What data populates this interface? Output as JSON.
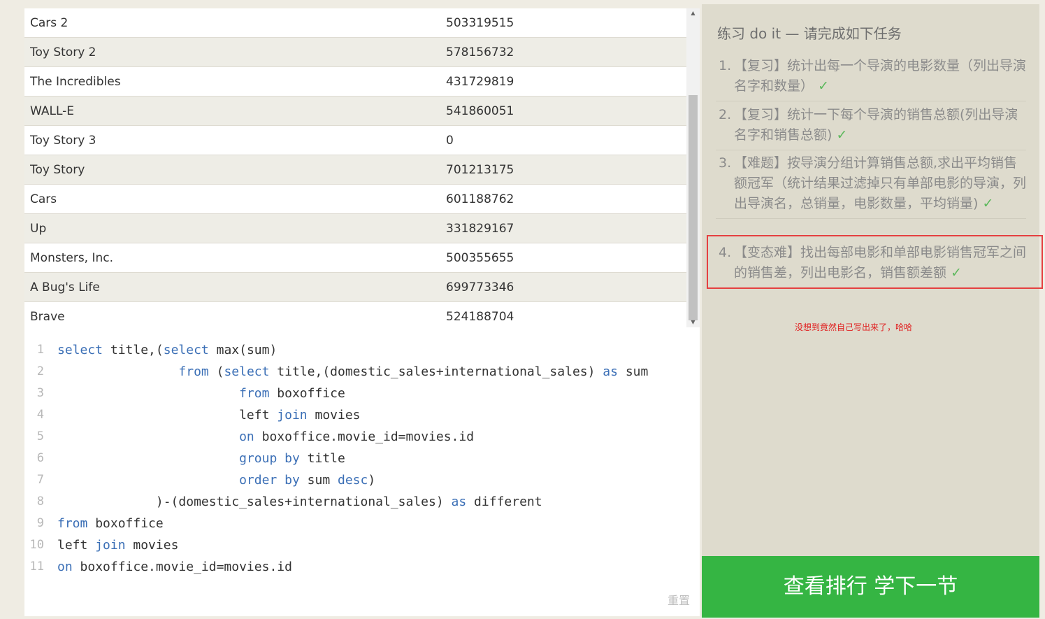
{
  "results": {
    "rows": [
      {
        "title": "Cars 2",
        "value": "503319515"
      },
      {
        "title": "Toy Story 2",
        "value": "578156732"
      },
      {
        "title": "The Incredibles",
        "value": "431729819"
      },
      {
        "title": "WALL-E",
        "value": "541860051"
      },
      {
        "title": "Toy Story 3",
        "value": "0"
      },
      {
        "title": "Toy Story",
        "value": "701213175"
      },
      {
        "title": "Cars",
        "value": "601188762"
      },
      {
        "title": "Up",
        "value": "331829167"
      },
      {
        "title": "Monsters, Inc.",
        "value": "500355655"
      },
      {
        "title": "A Bug's Life",
        "value": "699773346"
      },
      {
        "title": "Brave",
        "value": "524188704"
      }
    ]
  },
  "editor": {
    "lines": [
      [
        {
          "t": "select",
          "k": 1
        },
        {
          "t": " title,("
        },
        {
          "t": "select",
          "k": 1
        },
        {
          "t": " max(sum)"
        }
      ],
      [
        {
          "t": "                "
        },
        {
          "t": "from",
          "k": 1
        },
        {
          "t": " ("
        },
        {
          "t": "select",
          "k": 1
        },
        {
          "t": " title,(domestic_sales+international_sales) "
        },
        {
          "t": "as",
          "k": 1
        },
        {
          "t": " sum"
        }
      ],
      [
        {
          "t": "                        "
        },
        {
          "t": "from",
          "k": 1
        },
        {
          "t": " boxoffice"
        }
      ],
      [
        {
          "t": "                        left "
        },
        {
          "t": "join",
          "k": 1
        },
        {
          "t": " movies"
        }
      ],
      [
        {
          "t": "                        "
        },
        {
          "t": "on",
          "k": 1
        },
        {
          "t": " boxoffice.movie_id=movies.id"
        }
      ],
      [
        {
          "t": "                        "
        },
        {
          "t": "group",
          "k": 1
        },
        {
          "t": " "
        },
        {
          "t": "by",
          "k": 1
        },
        {
          "t": " title"
        }
      ],
      [
        {
          "t": "                        "
        },
        {
          "t": "order",
          "k": 1
        },
        {
          "t": " "
        },
        {
          "t": "by",
          "k": 1
        },
        {
          "t": " sum "
        },
        {
          "t": "desc",
          "k": 1
        },
        {
          "t": ")"
        }
      ],
      [
        {
          "t": "             )-(domestic_sales+international_sales) "
        },
        {
          "t": "as",
          "k": 1
        },
        {
          "t": " different"
        }
      ],
      [
        {
          "t": "from",
          "k": 1
        },
        {
          "t": " boxoffice"
        }
      ],
      [
        {
          "t": "left "
        },
        {
          "t": "join",
          "k": 1
        },
        {
          "t": " movies"
        }
      ],
      [
        {
          "t": "on",
          "k": 1
        },
        {
          "t": " boxoffice.movie_id=movies.id"
        }
      ]
    ],
    "reset_label": "重置"
  },
  "panel": {
    "title": "练习 do it — 请完成如下任务",
    "tasks": [
      {
        "num": "1.",
        "text": "【复习】统计出每一个导演的电影数量（列出导演名字和数量）",
        "check": "✓"
      },
      {
        "num": "2.",
        "text": "【复习】统计一下每个导演的销售总额(列出导演名字和销售总额)",
        "check": "✓"
      },
      {
        "num": "3.",
        "text": "【难题】按导演分组计算销售总额,求出平均销售额冠军（统计结果过滤掉只有单部电影的导演，列出导演名，总销量，电影数量，平均销量)",
        "check": "✓"
      },
      {
        "num": "4.",
        "text": "【变态难】找出每部电影和单部电影销售冠军之间的销售差，列出电影名，销售额差额",
        "check": "✓"
      }
    ],
    "note": "没想到竟然自己写出来了，哈哈",
    "next_button": "查看排行 学下一节"
  }
}
